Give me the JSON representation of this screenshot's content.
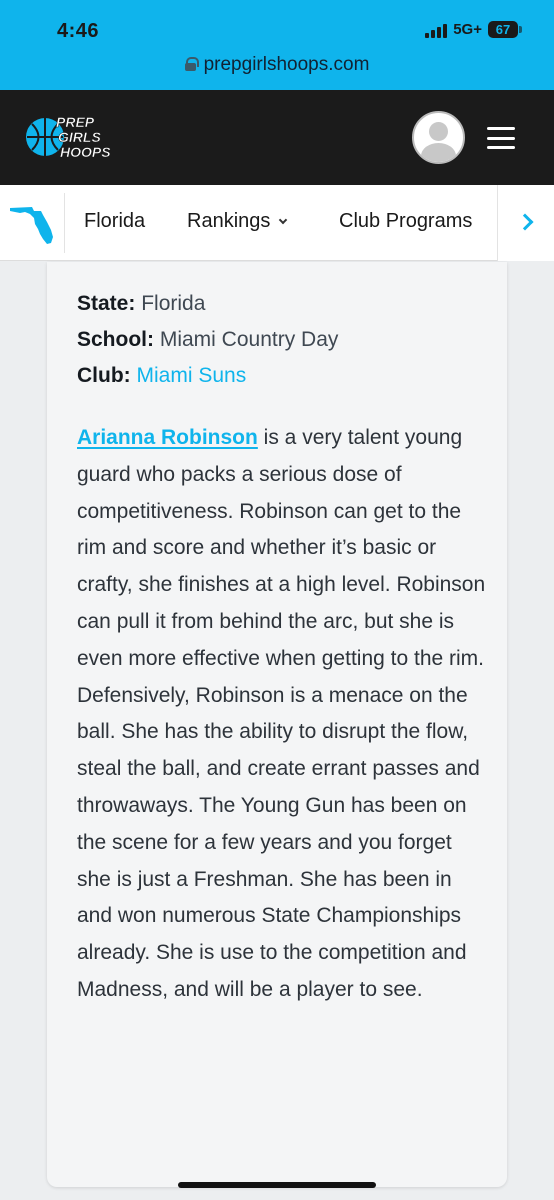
{
  "status_bar": {
    "time": "4:46",
    "network": "5G+",
    "battery": "67"
  },
  "browser": {
    "url": "prepgirlshoops.com"
  },
  "site": {
    "logo_lines": [
      "PREP",
      "GIRLS",
      "HOOPS"
    ],
    "brand_color": "#0fb4ec"
  },
  "nav": {
    "items": [
      {
        "label": "Florida"
      },
      {
        "label": "Rankings"
      },
      {
        "label": "Club Programs"
      }
    ]
  },
  "profile": {
    "state_label": "State:",
    "state_value": "Florida",
    "school_label": "School:",
    "school_value": "Miami Country Day",
    "club_label": "Club:",
    "club_value": "Miami Suns"
  },
  "bio": {
    "player_name": "Arianna Robinson",
    "text": " is a very talent young guard who packs a serious dose of competitiveness. Robinson can get to the rim and score and whether it’s basic or crafty, she finishes at a high level. Robinson can pull it from behind the arc, but she is even more effective when getting to the rim. Defensively, Robinson is a menace on the ball. She has the ability to disrupt the flow, steal the ball, and create errant passes and throwaways. The Young Gun has been on the scene for a few years and you forget she is just a Freshman. She has been in and won numerous State Championships already. She is use to the competition and Madness, and will be a player to see."
  }
}
